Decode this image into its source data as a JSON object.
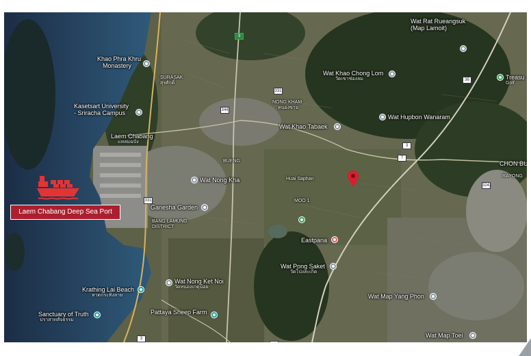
{
  "map": {
    "places": [
      {
        "id": "wat-rat-rueangsuk",
        "name": "Wat Rat Rueangsuk",
        "sub": "(Map Lamoit)",
        "icon": "temple-pin"
      },
      {
        "id": "khao-phra-khru",
        "name": "Khao Phra Khru",
        "sub": "Monastery",
        "icon": "temple-pin"
      },
      {
        "id": "surasak",
        "name": "SURASAK",
        "sub": "สุรศักดิ์",
        "icon": ""
      },
      {
        "id": "wat-khao-chong-lom",
        "name": "Wat Khao Chong Lom",
        "sub": "วัดเขาช่องลม",
        "icon": "temple-pin"
      },
      {
        "id": "treasure",
        "name": "Treasu",
        "sub": "Golf",
        "icon": "golf-pin"
      },
      {
        "id": "kasetsart",
        "name": "Kasetsart University",
        "sub": "- Sriracha Campus",
        "icon": "university-pin"
      },
      {
        "id": "nong-kham",
        "name": "NONG KHAM",
        "sub": "หนองขาม",
        "icon": ""
      },
      {
        "id": "wat-hupbon",
        "name": "Wat Hupbon Wanaram",
        "sub": "",
        "icon": "temple-pin"
      },
      {
        "id": "laem-chabang",
        "name": "Laem Chabang",
        "sub": "แหลมฉบัง",
        "icon": ""
      },
      {
        "id": "wat-khao-tabaek",
        "name": "Wat Khao Tabaek",
        "sub": "",
        "icon": "temple-pin"
      },
      {
        "id": "bueng",
        "name": "BUENG",
        "sub": "",
        "icon": ""
      },
      {
        "id": "chon-buri",
        "name": "CHON BU",
        "sub": "RAYONG",
        "icon": ""
      },
      {
        "id": "wat-nong-kha",
        "name": "Wat Nong Kha",
        "sub": "",
        "icon": "temple-pin"
      },
      {
        "id": "huai-saphan",
        "name": "Huai Saphan",
        "sub": "",
        "icon": ""
      },
      {
        "id": "ganesha-garden",
        "name": "Ganesha Garden",
        "sub": "",
        "icon": "temple-pin"
      },
      {
        "id": "bang-lamung",
        "name": "BANG LAMUNG",
        "sub": "DISTRICT",
        "icon": ""
      },
      {
        "id": "eastpana",
        "name": "Eastpana",
        "sub": "",
        "icon": "shop-pin"
      },
      {
        "id": "wat-pong-saket",
        "name": "Wat Pong Saket",
        "sub": "วัดโป่งสะเก็ต",
        "icon": "temple-pin"
      },
      {
        "id": "krathing-lai",
        "name": "Krathing Lai Beach",
        "sub": "หาดกระทิงลาย",
        "icon": "beach-pin"
      },
      {
        "id": "wat-nong-ket-noi",
        "name": "Wat Nong Ket Noi",
        "sub": "วัดหนองเกตุน้อย",
        "icon": "temple-pin"
      },
      {
        "id": "wat-map-yang-phon",
        "name": "Wat Map Yang Phon",
        "sub": "",
        "icon": "temple-pin"
      },
      {
        "id": "sanctuary",
        "name": "Sanctuary of Truth",
        "sub": "ปราสาทสัจธรรม",
        "icon": "landmark-pin"
      },
      {
        "id": "pattaya-sheep",
        "name": "Pattaya Sheep Farm",
        "sub": "",
        "icon": "farm-pin"
      },
      {
        "id": "wat-map-toei",
        "name": "Wat Map Toei",
        "sub": "",
        "icon": "temple-pin"
      },
      {
        "id": "moo-1",
        "name": "MOO 1",
        "sub": "",
        "icon": ""
      }
    ],
    "road_shields": [
      "3",
      "331",
      "344",
      "36",
      "3",
      "7",
      "3241",
      "331",
      "3",
      "36"
    ],
    "port": {
      "label": "Laem Chabang Deep Sea Port",
      "icon": "cargo-ship-icon",
      "color": "#e53333"
    },
    "marker": {
      "icon": "location-marker-icon",
      "color": "#d6202f"
    },
    "colors": {
      "sea": "#22384f",
      "land_dark": "#2b3a2a",
      "land_light": "#6c6b55",
      "label_box": "#ab1f2e"
    }
  }
}
